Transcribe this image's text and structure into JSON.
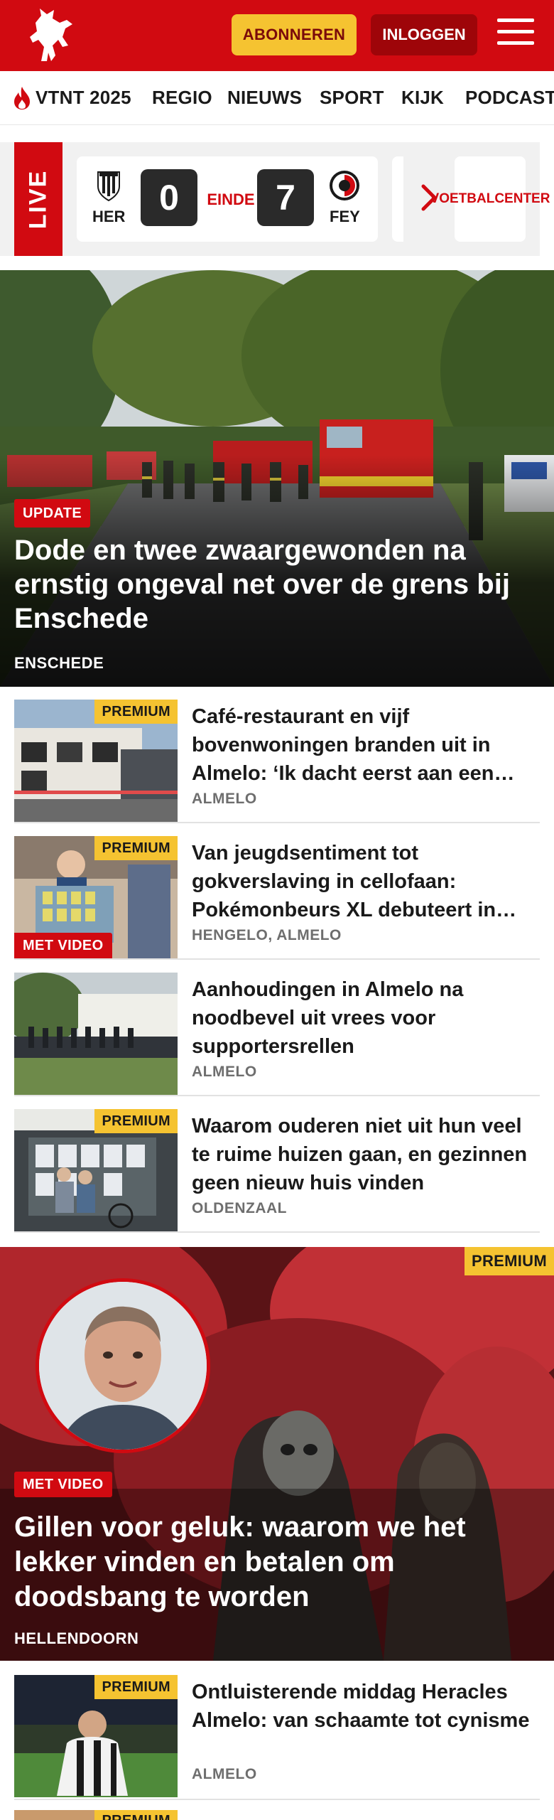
{
  "header": {
    "subscribe_label": "ABONNEREN",
    "login_label": "INLOGGEN",
    "brand_color": "#d10a11",
    "logo_icon": "tubantia-horse-logo",
    "menu_icon": "hamburger-icon"
  },
  "nav": {
    "items": [
      "VTNT 2025",
      "REGIO",
      "NIEUWS",
      "SPORT",
      "KIJK",
      "PODCAST"
    ]
  },
  "live": {
    "label": "LIVE",
    "match": {
      "home_code": "HER",
      "home_score": "0",
      "status": "EINDE",
      "away_code": "FEY",
      "away_score": "7"
    },
    "voetbalcenter_label": "VOETBAL CENTER"
  },
  "hero": {
    "badge": "UPDATE",
    "title": "Dode en twee zwaargewonden na ernstig ongeval net over de grens bij Enschede",
    "location": "ENSCHEDE"
  },
  "articles": [
    {
      "title": "Café-restaurant en vijf bovenwoningen branden uit in Almelo: ‘Ik dacht eerst aan een…",
      "location": "ALMELO",
      "premium": "PREMIUM",
      "video": ""
    },
    {
      "title": "Van jeugdsentiment tot gokverslaving in cellofaan: Pokémonbeurs XL debuteert in…",
      "location": "HENGELO, ALMELO",
      "premium": "PREMIUM",
      "video": "MET VIDEO"
    },
    {
      "title": "Aanhoudingen in Almelo na noodbevel uit vrees voor supportersrellen",
      "location": "ALMELO",
      "premium": "",
      "video": ""
    },
    {
      "title": "Waarom ouderen niet uit hun veel te ruime huizen gaan, en gezinnen geen nieuw huis vinden",
      "location": "OLDENZAAL",
      "premium": "PREMIUM",
      "video": ""
    }
  ],
  "feature": {
    "premium": "PREMIUM",
    "video": "MET VIDEO",
    "title": "Gillen voor geluk: waarom we het lekker vinden en betalen om doodsbang te worden",
    "location": "HELLENDOORN"
  },
  "bottom_article": {
    "title": "Ontluisterende middag Heracles Almelo: van schaamte tot cynisme",
    "location": "ALMELO",
    "premium": "PREMIUM"
  },
  "partial_article": {
    "premium": "PREMIUM"
  }
}
